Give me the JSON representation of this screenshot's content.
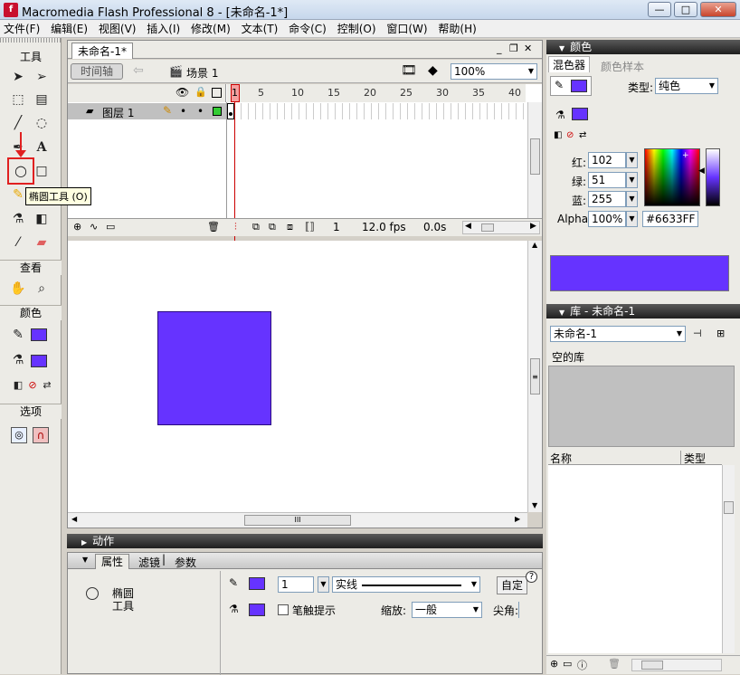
{
  "window": {
    "title": "Macromedia Flash Professional 8 - [未命名-1*]",
    "min": "—",
    "max": "□",
    "close": "✕"
  },
  "menu": [
    "文件(F)",
    "编辑(E)",
    "视图(V)",
    "插入(I)",
    "修改(M)",
    "文本(T)",
    "命令(C)",
    "控制(O)",
    "窗口(W)",
    "帮助(H)"
  ],
  "toolbox": {
    "title": "工具",
    "view": "查看",
    "colors": "颜色",
    "options": "选项",
    "tooltip": "椭圆工具 (O)"
  },
  "document": {
    "tab": "未命名-1*",
    "timeline_btn": "时间轴",
    "scene": "场景 1",
    "zoom": "100%",
    "ruler": [
      "5",
      "10",
      "15",
      "20",
      "25",
      "30",
      "35",
      "40"
    ],
    "layer": "图层 1",
    "frame": "1",
    "fps": "12.0 fps",
    "time": "0.0s",
    "scroll_grip": "III"
  },
  "stage_square_color": "#6633FF",
  "actions": {
    "label": "动作"
  },
  "properties": {
    "tabs": [
      "属性",
      "滤镜",
      "参数"
    ],
    "tool_name": "椭圆",
    "tool_name2": "工具",
    "stroke_width": "1",
    "stroke_style": "实线",
    "custom": "自定",
    "hint": "笔触提示",
    "scale_label": "缩放:",
    "scale_value": "一般",
    "cap_label": "尖角:",
    "help": "?"
  },
  "color_panel": {
    "title": "颜色",
    "tabs": [
      "混色器",
      "颜色样本"
    ],
    "type_label": "类型:",
    "type_value": "纯色",
    "red_label": "红:",
    "red": "102",
    "green_label": "绿:",
    "green": "51",
    "blue_label": "蓝:",
    "blue": "255",
    "alpha_label": "Alpha:",
    "alpha": "100%",
    "hex": "#6633FF",
    "swatch": "#6633FF"
  },
  "library": {
    "title": "库 - 未命名-1",
    "doc": "未命名-1",
    "empty": "空的库",
    "col_name": "名称",
    "col_type": "类型"
  }
}
